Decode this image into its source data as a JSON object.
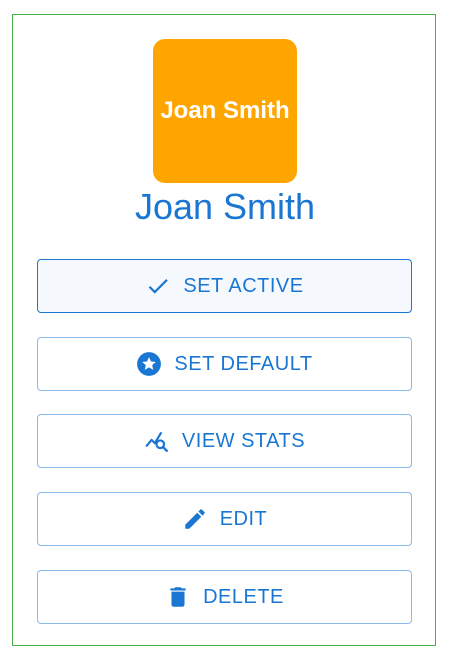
{
  "profile": {
    "avatar_text": "Joan Smith",
    "name": "Joan Smith",
    "avatar_color": "#ffa500"
  },
  "actions": {
    "set_active": {
      "label": "SET ACTIVE",
      "icon": "check-icon"
    },
    "set_default": {
      "label": "SET DEFAULT",
      "icon": "star-circle-icon"
    },
    "view_stats": {
      "label": "VIEW STATS",
      "icon": "chart-search-icon"
    },
    "edit": {
      "label": "EDIT",
      "icon": "pencil-icon"
    },
    "delete": {
      "label": "DELETE",
      "icon": "trash-icon"
    }
  },
  "colors": {
    "accent": "#1976d2",
    "card_border": "#4caf50"
  }
}
